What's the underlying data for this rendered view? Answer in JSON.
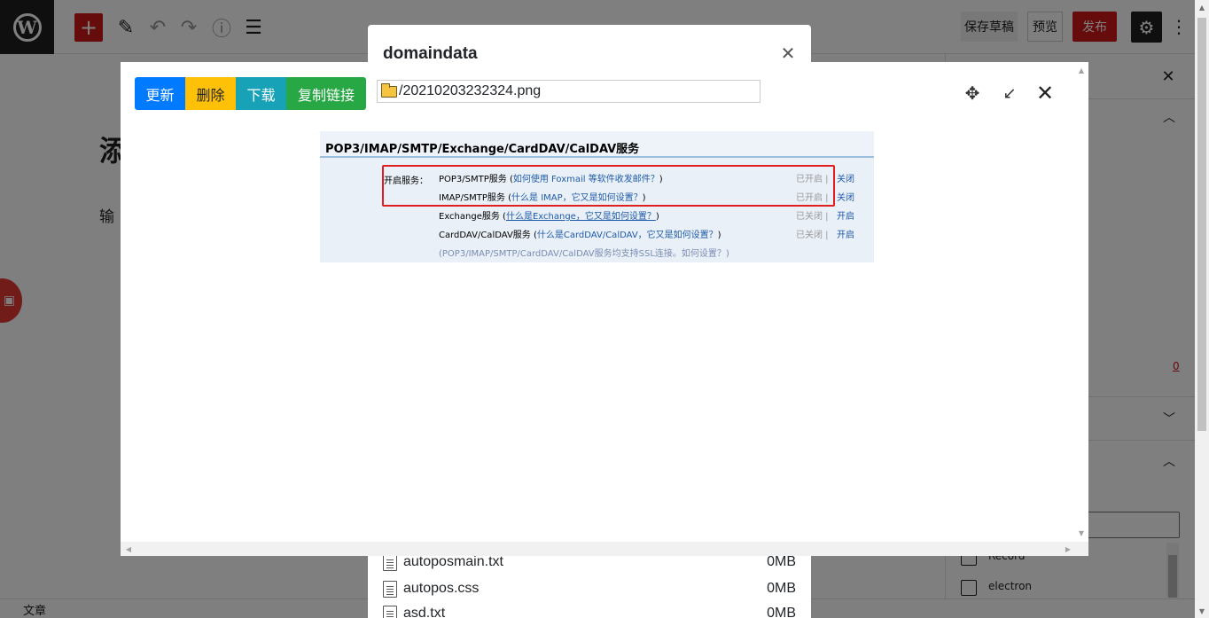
{
  "wp": {
    "title_char": "添",
    "para_char": "输",
    "save_draft": "保存草稿",
    "preview": "预览",
    "publish": "发布",
    "footer_label": "文章",
    "sidebar_zero": "0",
    "sidebar_checks": [
      "Record",
      "electron"
    ]
  },
  "file_manager": {
    "title": "domaindata",
    "files": [
      {
        "name": "autoposmain.txt",
        "size": "0MB"
      },
      {
        "name": "autopos.css",
        "size": "0MB"
      },
      {
        "name": "asd.txt",
        "size": "0MB"
      }
    ]
  },
  "viewer": {
    "buttons": {
      "update": "更新",
      "delete": "删除",
      "download": "下载",
      "copy_link": "复制链接"
    },
    "path": "/20210203232324.png"
  },
  "image": {
    "title": "POP3/IMAP/SMTP/Exchange/CardDAV/CalDAV服务",
    "open_label": "开启服务：",
    "rows": [
      {
        "name": "POP3/SMTP服务 (",
        "link": "如何使用 Foxmail 等软件收发邮件？",
        "tail": ")",
        "status": "已开启 |",
        "action": "关闭"
      },
      {
        "name": "IMAP/SMTP服务 (",
        "link": "什么是 IMAP，它又是如何设置？",
        "tail": ")",
        "status": "已开启 |",
        "action": "关闭"
      },
      {
        "name": "Exchange服务 (",
        "link": "什么是Exchange，它又是如何设置？",
        "tail": ")",
        "status": "已关闭 |",
        "action": "开启"
      },
      {
        "name": "CardDAV/CalDAV服务 (",
        "link": "什么是CardDAV/CalDAV，它又是如何设置？",
        "tail": ")",
        "status": "已关闭 |",
        "action": "开启"
      }
    ],
    "note": "(POP3/IMAP/SMTP/CardDAV/CalDAV服务均支持SSL连接。如何设置？)"
  }
}
